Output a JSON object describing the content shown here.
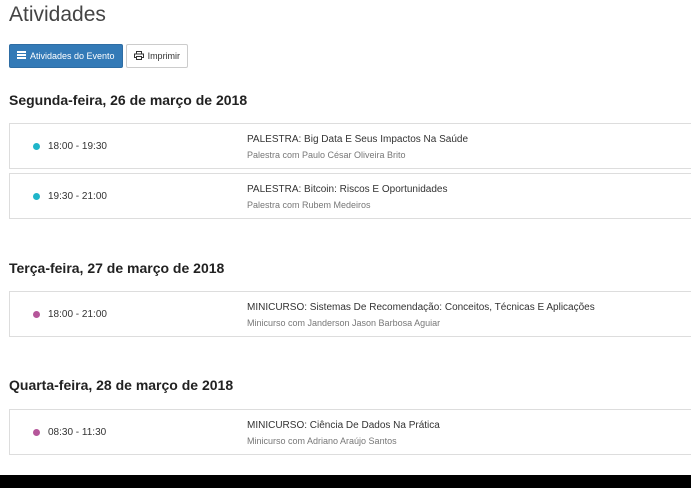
{
  "page": {
    "title": "Atividades"
  },
  "toolbar": {
    "event_activities_label": "Atividades do Evento",
    "print_label": "Imprimir",
    "event_activities_icon": "list-icon",
    "print_icon": "printer-icon"
  },
  "colors": {
    "palestra": "#1fb5c9",
    "minicurso": "#b5569a",
    "primary": "#337ab7"
  },
  "days": [
    {
      "heading": "Segunda-feira, 26 de março de 2018",
      "activities": [
        {
          "time": "18:00 - 19:30",
          "title": "PALESTRA: Big Data E Seus Impactos Na Saúde",
          "subtitle": "Palestra com Paulo César Oliveira Brito",
          "kind": "palestra"
        },
        {
          "time": "19:30 - 21:00",
          "title": "PALESTRA: Bitcoin: Riscos E Oportunidades",
          "subtitle": "Palestra com Rubem Medeiros",
          "kind": "palestra"
        }
      ]
    },
    {
      "heading": "Terça-feira, 27 de março de 2018",
      "activities": [
        {
          "time": "18:00 - 21:00",
          "title": "MINICURSO: Sistemas De Recomendação: Conceitos, Técnicas E Aplicações",
          "subtitle": "Minicurso com Janderson Jason Barbosa Aguiar",
          "kind": "minicurso"
        }
      ]
    },
    {
      "heading": "Quarta-feira, 28 de março de 2018",
      "activities": [
        {
          "time": "08:30 - 11:30",
          "title": "MINICURSO: Ciência De Dados Na Prática",
          "subtitle": "Minicurso com Adriano Araújo Santos",
          "kind": "minicurso"
        }
      ]
    }
  ]
}
